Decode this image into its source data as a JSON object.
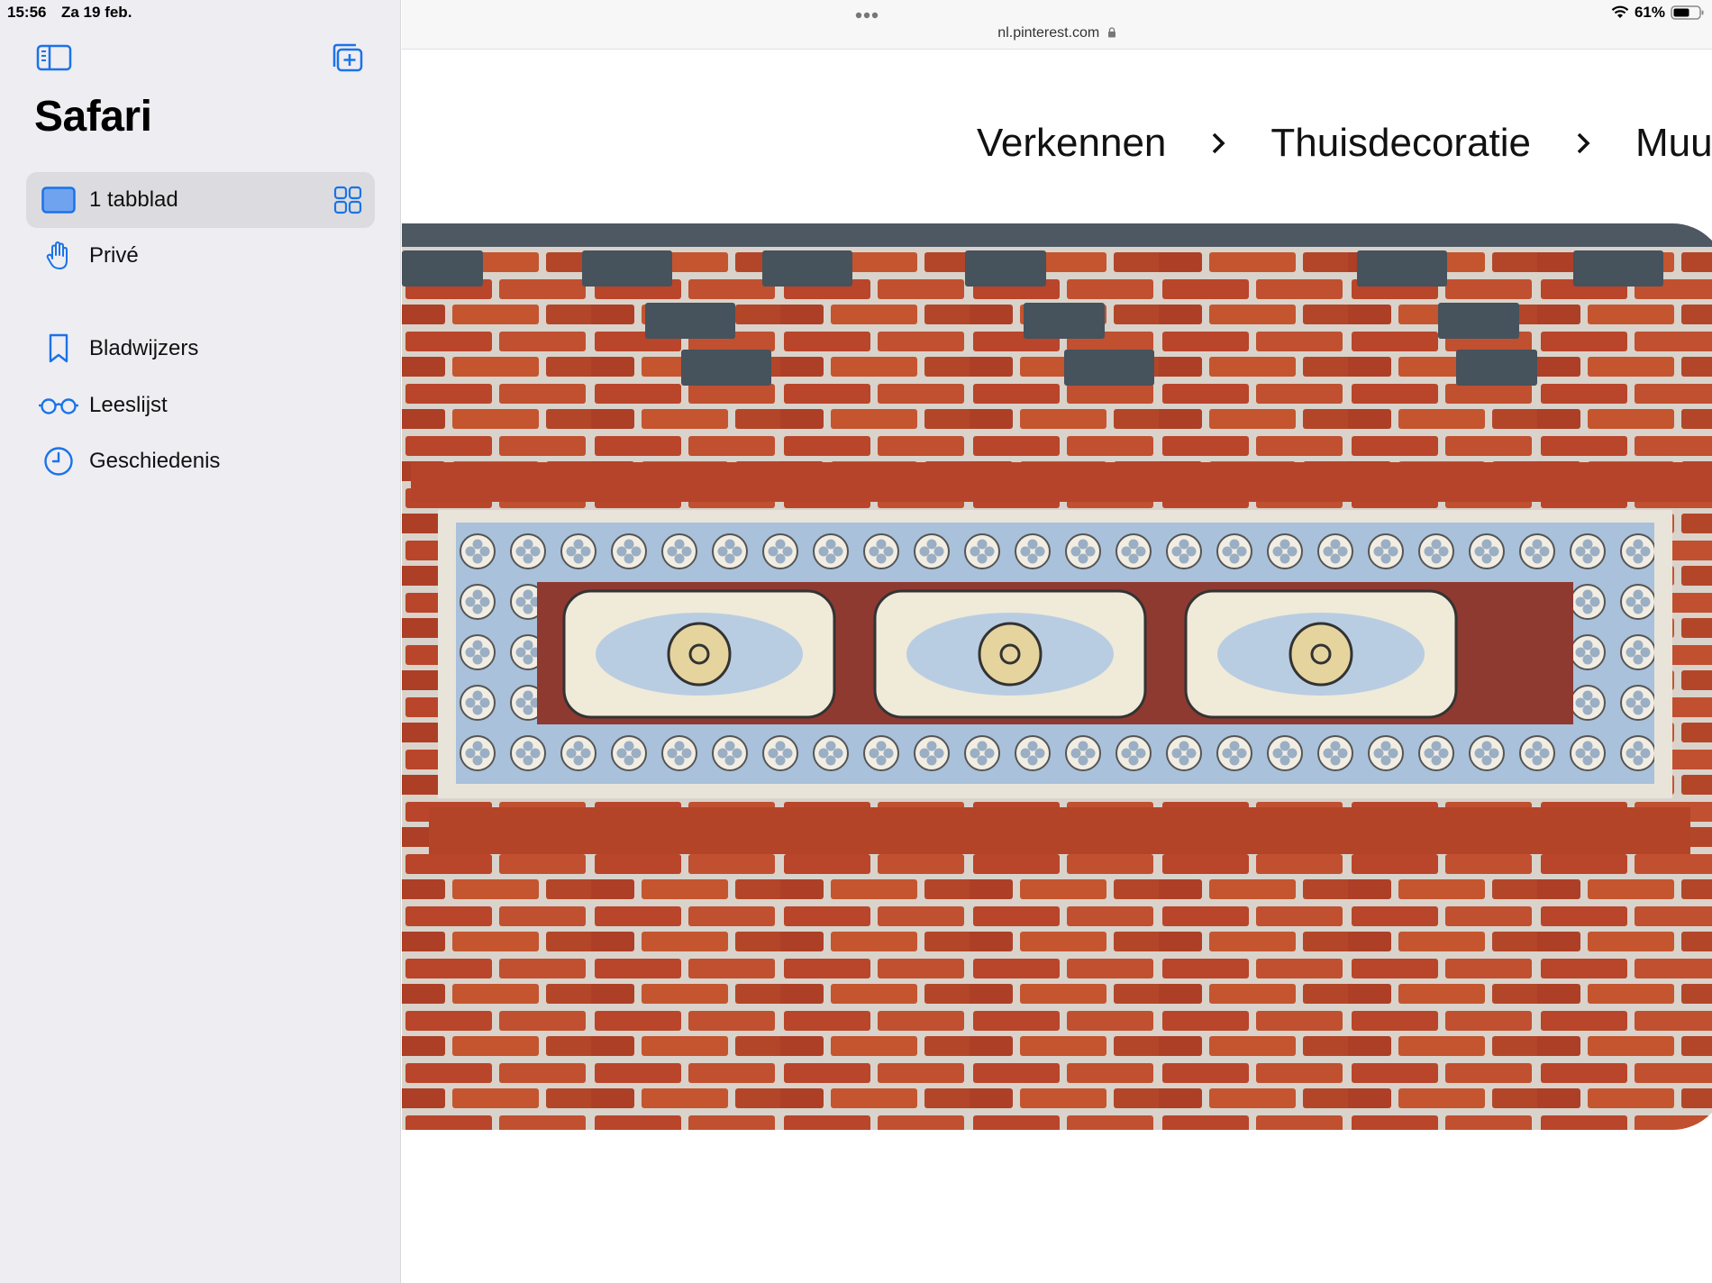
{
  "status": {
    "time": "15:56",
    "date": "Za 19 feb.",
    "battery": "61%"
  },
  "sidebar": {
    "title": "Safari",
    "items": [
      {
        "label": "1 tabblad",
        "icon": "tab-icon",
        "active": true
      },
      {
        "label": "Privé",
        "icon": "hand-icon"
      },
      {
        "label": "Bladwijzers",
        "icon": "bookmark-icon"
      },
      {
        "label": "Leeslijst",
        "icon": "glasses-icon"
      },
      {
        "label": "Geschiedenis",
        "icon": "clock-icon"
      }
    ]
  },
  "browser": {
    "url": "nl.pinterest.com"
  },
  "breadcrumbs": [
    "Verkennen",
    "Thuisdecoratie",
    "Muu"
  ],
  "image": {
    "subject": "brick-wall-with-tile-panel"
  },
  "colors": {
    "accent": "#1a73e8",
    "sidebar_bg": "#eeedf2",
    "brick": "#b9452a"
  }
}
